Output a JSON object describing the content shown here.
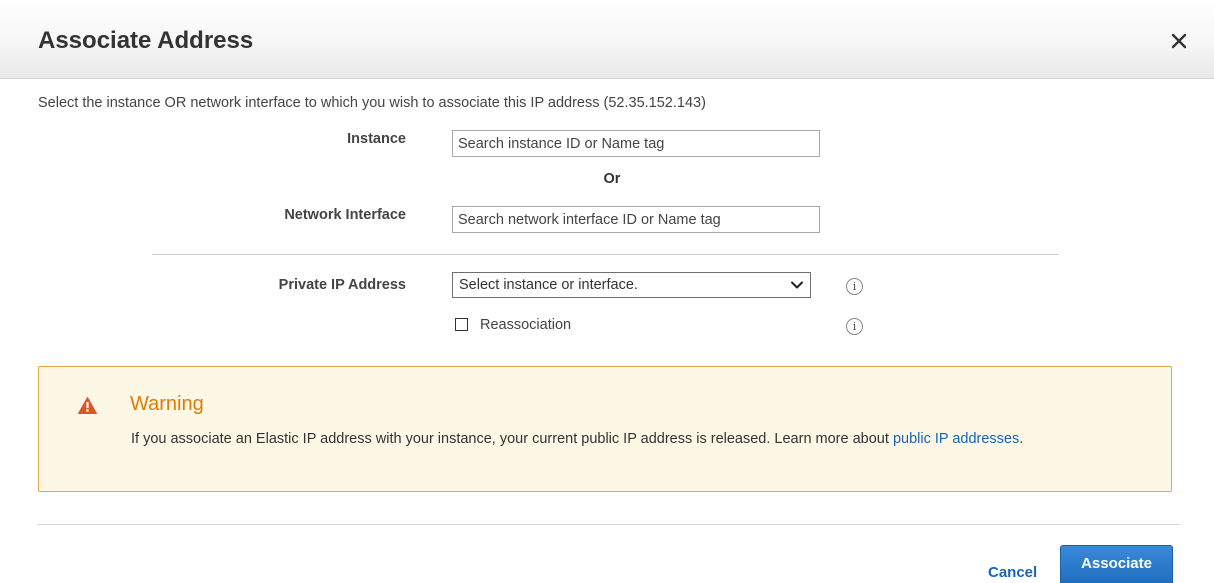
{
  "dialog": {
    "title": "Associate Address",
    "intro": "Select the instance OR network interface to which you wish to associate this IP address (52.35.152.143)"
  },
  "form": {
    "instance_label": "Instance",
    "instance_placeholder": "Search instance ID or Name tag",
    "or_label": "Or",
    "network_interface_label": "Network Interface",
    "network_interface_placeholder": "Search network interface ID or Name tag",
    "private_ip_label": "Private IP Address",
    "private_ip_selected": "Select instance or interface.",
    "reassociation_label": "Reassociation",
    "reassociation_checked": false,
    "info_glyph": "i"
  },
  "warning": {
    "title": "Warning",
    "body": "If you associate an Elastic IP address with your instance, your current public IP address is released. Learn more about ",
    "link_text": "public IP addresses",
    "trailing": ".",
    "accent_color": "#e07b00",
    "background_color": "#fdf8e6"
  },
  "footer": {
    "cancel_label": "Cancel",
    "associate_label": "Associate"
  },
  "icons": {
    "close": "close-icon",
    "warning": "warning-icon",
    "info": "info-icon",
    "dropdown": "chevron-down-icon"
  }
}
